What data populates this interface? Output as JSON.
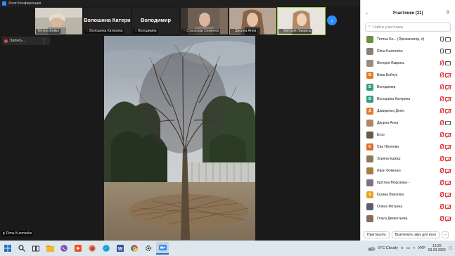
{
  "window": {
    "title": "Zoom Конференция"
  },
  "gallery": [
    {
      "name": "Тетяна Бойко",
      "type": "video",
      "muted": false
    },
    {
      "name": "Волошина Катерина",
      "big_name": "Волошина Катерина",
      "type": "name",
      "muted": true
    },
    {
      "name": "Володимир",
      "big_name": "Володимир",
      "type": "name",
      "muted": true
    },
    {
      "name": "Станіслав Семенюк",
      "type": "video",
      "muted": true
    },
    {
      "name": "Дворна Анна",
      "type": "video",
      "muted": true
    },
    {
      "name": "Вікторія Лаврись",
      "type": "video",
      "muted": true,
      "active": true
    }
  ],
  "recording": {
    "label": "Запись..."
  },
  "active_speaker": {
    "name": "Dima Kuzmenko"
  },
  "participants_panel": {
    "title": "Участники (21)",
    "search_placeholder": "Найти участника",
    "participants": [
      {
        "name": "Тетяна Бо... (Организатор, я)",
        "initial": "",
        "color": "#6b8f3a",
        "mic": "on",
        "cam": "on"
      },
      {
        "name": "Dima Kuzmenko",
        "initial": "",
        "color": "#8a7f74",
        "mic": "on",
        "cam": "on"
      },
      {
        "name": "Вікторія Лаврись",
        "initial": "",
        "color": "#9a8b80",
        "mic": "muted",
        "cam": "on"
      },
      {
        "name": "Вова Бойчук",
        "initial": "В",
        "color": "#e07b27",
        "mic": "muted",
        "cam": "off"
      },
      {
        "name": "Володимир",
        "initial": "В",
        "color": "#2f9e7b",
        "mic": "muted",
        "cam": "off"
      },
      {
        "name": "Волошина Катерина",
        "initial": "В",
        "color": "#2f9e7b",
        "mic": "muted",
        "cam": "off"
      },
      {
        "name": "Давиденко Деніс",
        "initial": "Д",
        "color": "#e07b27",
        "mic": "muted",
        "cam": "off"
      },
      {
        "name": "Дворна Анна",
        "initial": "",
        "color": "#b0836b",
        "mic": "muted",
        "cam": "on"
      },
      {
        "name": "Егор",
        "initial": "",
        "color": "#6d5a46",
        "mic": "muted",
        "cam": "off"
      },
      {
        "name": "Єва Ніконова",
        "initial": "Є",
        "color": "#e06a27",
        "mic": "muted",
        "cam": "off"
      },
      {
        "name": "Зоряна Ешкар",
        "initial": "",
        "color": "#8e7a5f",
        "mic": "muted",
        "cam": "off"
      },
      {
        "name": "Иван Фоменко",
        "initial": "",
        "color": "#a67d3f",
        "mic": "muted",
        "cam": "off"
      },
      {
        "name": "Крістіна Морозова⋯",
        "initial": "",
        "color": "#7d6f8f",
        "mic": "muted",
        "cam": "off"
      },
      {
        "name": "Кузина Вероніка",
        "initial": "К",
        "color": "#f0a020",
        "mic": "muted",
        "cam": "off"
      },
      {
        "name": "Олена Мотузна",
        "initial": "",
        "color": "#5d5d6d",
        "mic": "muted",
        "cam": "off"
      },
      {
        "name": "Ольга Дементьева",
        "initial": "",
        "color": "#8a6d5a",
        "mic": "muted",
        "cam": "off"
      }
    ],
    "invite_label": "Пригласить",
    "mute_all_label": "Выключить звук для всех",
    "more_label": "···"
  },
  "taskbar": {
    "weather": "5°C  Cloudy",
    "language": "УКР",
    "time": "13:20",
    "date": "03.03.2023"
  }
}
